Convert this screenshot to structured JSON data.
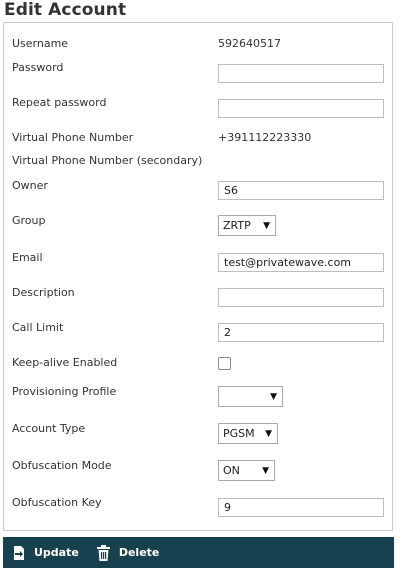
{
  "title": "Edit Account",
  "fields": {
    "username": {
      "label": "Username",
      "value": "592640517"
    },
    "password": {
      "label": "Password",
      "value": ""
    },
    "repeat_password": {
      "label": "Repeat password",
      "value": ""
    },
    "virtual_phone": {
      "label": "Virtual Phone Number",
      "value": "+391112223330"
    },
    "virtual_phone_secondary": {
      "label": "Virtual Phone Number (secondary)",
      "value": ""
    },
    "owner": {
      "label": "Owner",
      "value": "S6"
    },
    "group": {
      "label": "Group",
      "value": "ZRTP"
    },
    "email": {
      "label": "Email",
      "value": "test@privatewave.com"
    },
    "description": {
      "label": "Description",
      "value": ""
    },
    "call_limit": {
      "label": "Call Limit",
      "value": "2"
    },
    "keep_alive": {
      "label": "Keep-alive Enabled",
      "checked": false
    },
    "provisioning_profile": {
      "label": "Provisioning Profile",
      "value": ""
    },
    "account_type": {
      "label": "Account Type",
      "value": "PGSM"
    },
    "obfuscation_mode": {
      "label": "Obfuscation Mode",
      "value": "ON"
    },
    "obfuscation_key": {
      "label": "Obfuscation Key",
      "value": "9"
    }
  },
  "footer": {
    "update_label": "Update",
    "delete_label": "Delete",
    "update_icon": "update-icon",
    "delete_icon": "trash-icon",
    "background": "#17414f"
  }
}
